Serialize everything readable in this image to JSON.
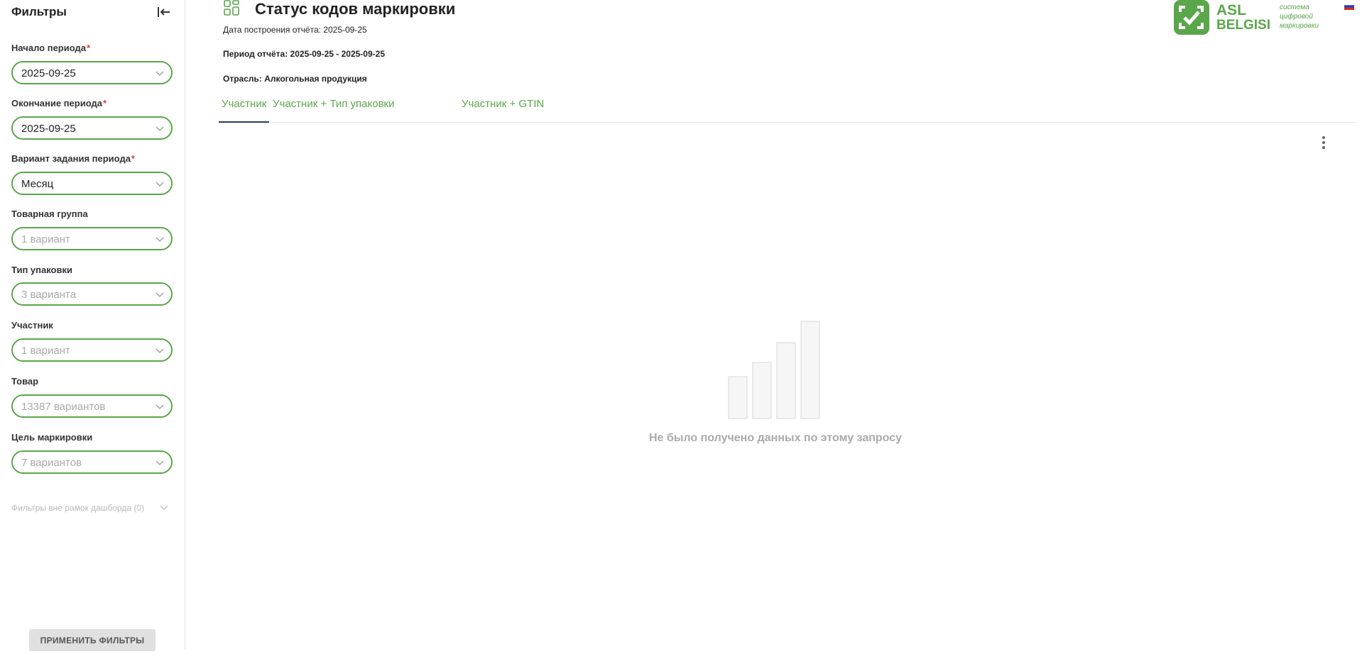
{
  "sidebar": {
    "title": "Фильтры",
    "filters": [
      {
        "label": "Начало периода",
        "required": "*",
        "value": "2025-09-25",
        "placeholder": false
      },
      {
        "label": "Окончание периода",
        "required": "*",
        "value": "2025-09-25",
        "placeholder": false
      },
      {
        "label": "Вариант задания периода",
        "required": "*",
        "value": "Месяц",
        "placeholder": false
      },
      {
        "label": "Товарная группа",
        "value": "1 вариант",
        "placeholder": true
      },
      {
        "label": "Тип упаковки",
        "value": "3 варианта",
        "placeholder": true
      },
      {
        "label": "Участник",
        "value": "1 вариант",
        "placeholder": true
      },
      {
        "label": "Товар",
        "value": "13387 вариантов",
        "placeholder": true
      },
      {
        "label": "Цель маркировки",
        "value": "7 вариантов",
        "placeholder": true
      }
    ],
    "outside_filters": "Фильтры вне рамок дашборда (0)",
    "apply_label": "ПРИМЕНИТЬ ФИЛЬТРЫ"
  },
  "header": {
    "title": "Статус кодов маркировки",
    "build_date": "Дата построения отчёта: 2025-09-25",
    "period": "Период отчёта: 2025-09-25 - 2025-09-25",
    "industry": "Отрасль: Алкогольная продукция"
  },
  "logo": {
    "line1": "ASL",
    "line2": "BELGISI",
    "tag1": "система",
    "tag2": "цифровой",
    "tag3": "маркировки"
  },
  "tabs": [
    {
      "label": "Участник",
      "active": true
    },
    {
      "label": "Участник + Тип упаковки",
      "active": false
    },
    {
      "label": "Участник + GTIN",
      "active": false
    }
  ],
  "empty_state": {
    "message": "Не было получено данных по этому запросу"
  },
  "colors": {
    "accent": "#5aa64a",
    "active_tab_underline": "#2c3970",
    "required": "#e23b3b"
  }
}
